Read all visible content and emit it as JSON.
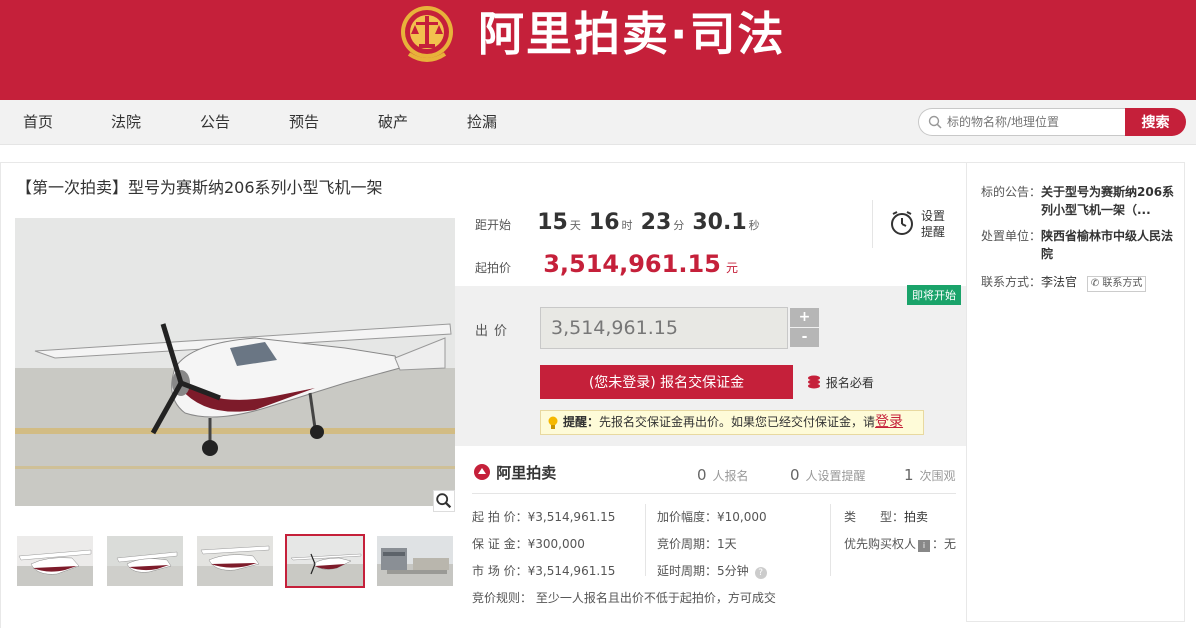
{
  "banner": {
    "brand": "阿里拍卖·司法",
    "brand_color": "#c5203a"
  },
  "nav": {
    "items": [
      "首页",
      "法院",
      "公告",
      "预告",
      "破产",
      "捡漏"
    ],
    "search_placeholder": "标的物名称/地理位置",
    "search_button": "搜索"
  },
  "auction": {
    "title": "【第一次拍卖】型号为赛斯纳206系列小型飞机一架",
    "countdown_label": "距开始",
    "countdown": {
      "days": "15",
      "days_unit": "天",
      "hours": "16",
      "hours_unit": "时",
      "minutes": "23",
      "minutes_unit": "分",
      "seconds": "30.1",
      "seconds_unit": "秒"
    },
    "remind_label": "设置提醒",
    "start_price_label": "起拍价",
    "start_price": "3,514,961.15",
    "currency_unit": "元",
    "status_badge": "即将开始",
    "bid_label": "出价",
    "bid_value": "3,514,961.15",
    "plus": "+",
    "minus": "-",
    "deposit_button": "(您未登录) 报名交保证金",
    "must_read": "报名必看",
    "tip_prefix": "提醒：",
    "tip_text": "先报名交保证金再出价。如果您已经交付保证金，请",
    "tip_link": "登录"
  },
  "stats": {
    "logo": "阿里拍卖",
    "signups": "0",
    "signups_label": "人报名",
    "reminders": "0",
    "reminders_label": "人设置提醒",
    "views": "1",
    "views_label": "次围观"
  },
  "details": {
    "start_price": "起 拍 价：¥3,514,961.15",
    "deposit": "保 证 金：¥300,000",
    "market_price": "市 场 价：¥3,514,961.15",
    "increment": "加价幅度：¥10,000",
    "cycle": "竞价周期：1天",
    "delay": "延时周期：5分钟",
    "type_key": "类　　型：",
    "type_val": "拍卖",
    "priority_key": "优先购买权人",
    "priority_val": "：无",
    "rule": "竞价规则：  至少一人报名且出价不低于起拍价，方可成交"
  },
  "side": {
    "notice_key": "标的公告：",
    "notice_val": "关于型号为赛斯纳206系列小型飞机一架（...",
    "court_key": "处置单位：",
    "court_val": "陕西省榆林市中级人民法院",
    "contact_key": "联系方式：",
    "contact_val": "李法官",
    "contact_button": "联系方式"
  }
}
